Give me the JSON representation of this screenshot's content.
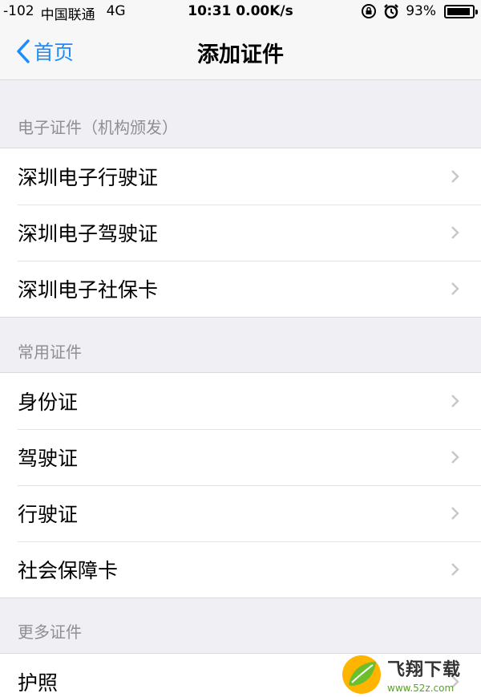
{
  "status_bar": {
    "signal": "-102",
    "carrier": "中国联通",
    "network": "4G",
    "time_speed": "10:31 0.00K/s",
    "battery": "93%",
    "battery_level": 0.93
  },
  "nav": {
    "back_label": "首页",
    "title": "添加证件"
  },
  "sections": [
    {
      "header": "电子证件（机构颁发）",
      "items": [
        "深圳电子行驶证",
        "深圳电子驾驶证",
        "深圳电子社保卡"
      ]
    },
    {
      "header": "常用证件",
      "items": [
        "身份证",
        "驾驶证",
        "行驶证",
        "社会保障卡"
      ]
    },
    {
      "header": "更多证件",
      "items": [
        "护照"
      ]
    }
  ],
  "watermark": {
    "title": "飞翔下载",
    "url": "www.52z.com"
  },
  "colors": {
    "accent": "#1a8cff",
    "background": "#efeff4",
    "header_text": "#8e8e93"
  }
}
